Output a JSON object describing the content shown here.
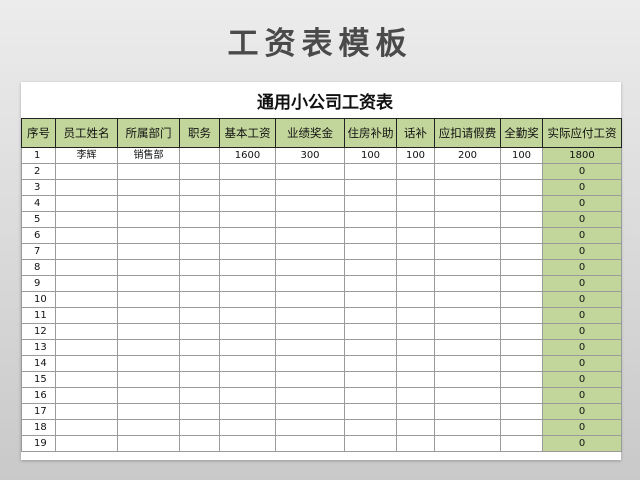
{
  "poster_title": "工资表模板",
  "sheet": {
    "title": "通用小公司工资表",
    "columns": [
      "序号",
      "员工姓名",
      "所属部门",
      "职务",
      "基本工资",
      "业绩奖金",
      "住房补助",
      "话补",
      "应扣请假费",
      "全勤奖",
      "实际应付工资"
    ],
    "rows": [
      [
        "1",
        "李辉",
        "销售部",
        "",
        "1600",
        "300",
        "100",
        "100",
        "200",
        "100",
        "1800"
      ],
      [
        "2",
        "",
        "",
        "",
        "",
        "",
        "",
        "",
        "",
        "",
        "0"
      ],
      [
        "3",
        "",
        "",
        "",
        "",
        "",
        "",
        "",
        "",
        "",
        "0"
      ],
      [
        "4",
        "",
        "",
        "",
        "",
        "",
        "",
        "",
        "",
        "",
        "0"
      ],
      [
        "5",
        "",
        "",
        "",
        "",
        "",
        "",
        "",
        "",
        "",
        "0"
      ],
      [
        "6",
        "",
        "",
        "",
        "",
        "",
        "",
        "",
        "",
        "",
        "0"
      ],
      [
        "7",
        "",
        "",
        "",
        "",
        "",
        "",
        "",
        "",
        "",
        "0"
      ],
      [
        "8",
        "",
        "",
        "",
        "",
        "",
        "",
        "",
        "",
        "",
        "0"
      ],
      [
        "9",
        "",
        "",
        "",
        "",
        "",
        "",
        "",
        "",
        "",
        "0"
      ],
      [
        "10",
        "",
        "",
        "",
        "",
        "",
        "",
        "",
        "",
        "",
        "0"
      ],
      [
        "11",
        "",
        "",
        "",
        "",
        "",
        "",
        "",
        "",
        "",
        "0"
      ],
      [
        "12",
        "",
        "",
        "",
        "",
        "",
        "",
        "",
        "",
        "",
        "0"
      ],
      [
        "13",
        "",
        "",
        "",
        "",
        "",
        "",
        "",
        "",
        "",
        "0"
      ],
      [
        "14",
        "",
        "",
        "",
        "",
        "",
        "",
        "",
        "",
        "",
        "0"
      ],
      [
        "15",
        "",
        "",
        "",
        "",
        "",
        "",
        "",
        "",
        "",
        "0"
      ],
      [
        "16",
        "",
        "",
        "",
        "",
        "",
        "",
        "",
        "",
        "",
        "0"
      ],
      [
        "17",
        "",
        "",
        "",
        "",
        "",
        "",
        "",
        "",
        "",
        "0"
      ],
      [
        "18",
        "",
        "",
        "",
        "",
        "",
        "",
        "",
        "",
        "",
        "0"
      ],
      [
        "19",
        "",
        "",
        "",
        "",
        "",
        "",
        "",
        "",
        "",
        "0"
      ]
    ]
  },
  "colors": {
    "header_fill": "#c2d69b",
    "total_fill": "#c2d69b",
    "title_text": "#4a4a4a"
  }
}
